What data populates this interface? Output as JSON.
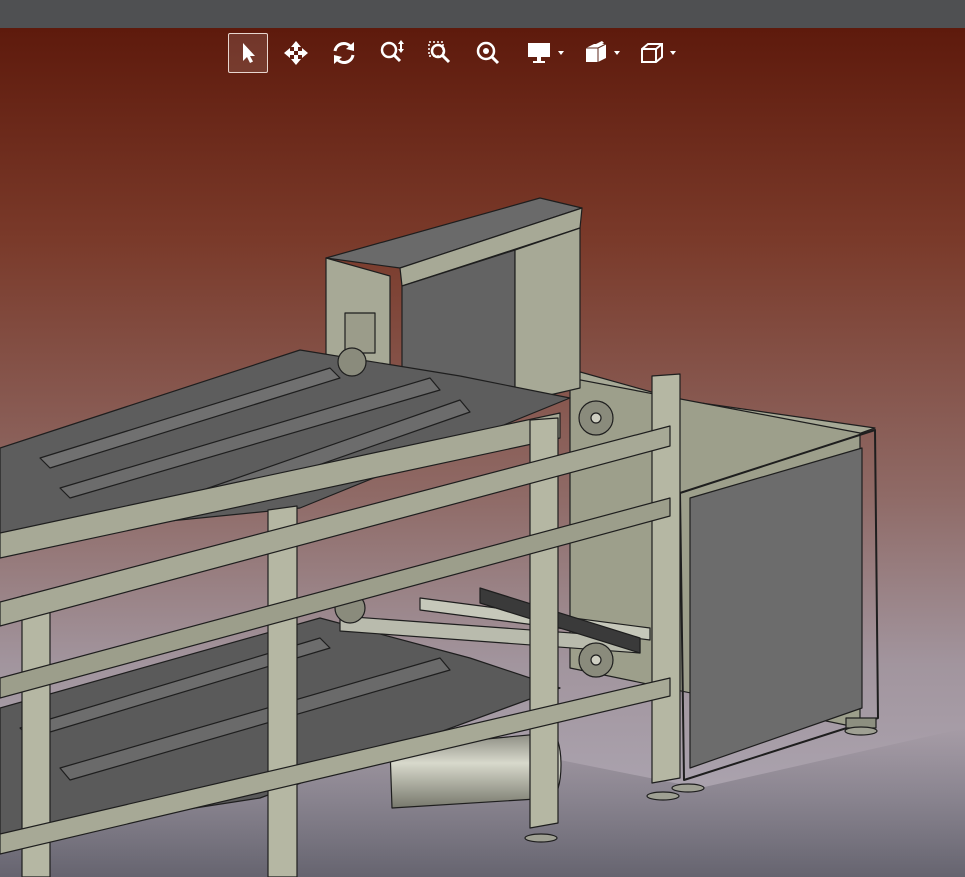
{
  "app": {
    "window": "CAD 3D viewport"
  },
  "toolbar": {
    "items": [
      {
        "name": "select-icon",
        "tooltip": "",
        "active": true
      },
      {
        "name": "pan-icon"
      },
      {
        "name": "rotate-icon"
      },
      {
        "name": "zoom-in-out-icon"
      },
      {
        "name": "zoom-window-icon"
      },
      {
        "name": "zoom-fit-icon"
      },
      {
        "name": "display-mode-icon",
        "dropdown": true
      },
      {
        "name": "section-icon",
        "dropdown": true
      },
      {
        "name": "view-cube-icon",
        "dropdown": true
      }
    ],
    "icon_color": "#ffffff"
  },
  "scene": {
    "description_colors": {
      "frame": "#a7a996",
      "panel": "#6b6b6b",
      "panel_dark": "#555555",
      "outline": "#1e1e1e",
      "background_top": "#5e1a0c",
      "background_bottom": "#b0acb9"
    }
  }
}
